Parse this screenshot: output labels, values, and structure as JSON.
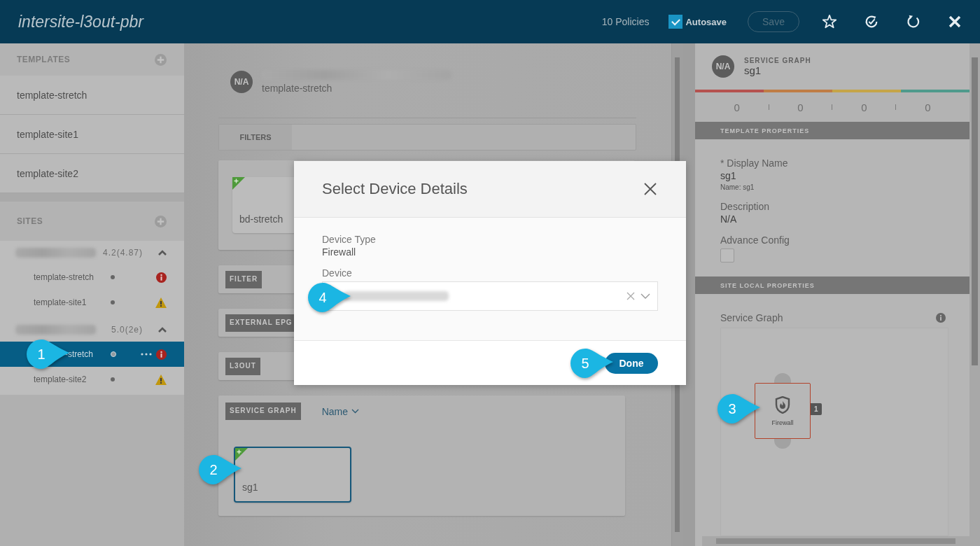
{
  "header": {
    "title": "intersite-l3out-pbr",
    "policies": "10 Policies",
    "autosave": {
      "label": "Autosave",
      "checked": true
    },
    "save": {
      "label": "Save",
      "disabled": true
    }
  },
  "sidebar": {
    "templates": {
      "heading": "TEMPLATES",
      "items": [
        {
          "label": "template-stretch",
          "selected": false
        },
        {
          "label": "template-site1",
          "selected": false
        },
        {
          "label": "template-site2",
          "selected": false
        }
      ]
    },
    "sites": {
      "heading": "SITES",
      "groups": [
        {
          "version": "4.2(4.87)",
          "expanded": true,
          "children": [
            {
              "label": "template-stretch",
              "kind": "error",
              "selected": false
            },
            {
              "label": "template-site1",
              "kind": "warning",
              "selected": false
            }
          ]
        },
        {
          "version": "5.0(2e)",
          "expanded": true,
          "children": [
            {
              "label": "-stretch",
              "kind": "error",
              "selected": true
            },
            {
              "label": "template-site2",
              "kind": "warning",
              "selected": false
            }
          ]
        }
      ]
    }
  },
  "schema": {
    "avatar": "N/A",
    "template": "template-stretch",
    "filters_label": "FILTERS",
    "bd_card": {
      "label": "bd-stretch",
      "added": true
    },
    "sections": [
      {
        "label": "FILTER"
      },
      {
        "label": "EXTERNAL EPG"
      },
      {
        "label": "L3OUT"
      }
    ],
    "service_graph": {
      "label": "SERVICE GRAPH",
      "sort": "Name",
      "cards": [
        {
          "label": "sg1",
          "added": true,
          "selected": true
        }
      ]
    }
  },
  "modal": {
    "title": "Select Device Details",
    "device_type_label": "Device Type",
    "device_type": "Firewall",
    "device_label": "Device",
    "done": "Done"
  },
  "properties": {
    "avatar": "N/A",
    "kind": "SERVICE GRAPH",
    "name": "sg1",
    "counts": [
      {
        "value": "0",
        "color": "#b5524f"
      },
      {
        "value": "0",
        "color": "#bf7d45"
      },
      {
        "value": "0",
        "color": "#c5a548"
      },
      {
        "value": "0",
        "color": "#4f9a8c"
      }
    ],
    "template_heading": "TEMPLATE PROPERTIES",
    "display_name_label": "* Display Name",
    "display_name": "sg1",
    "name_note": "Name: sg1",
    "description_label": "Description",
    "description": "N/A",
    "advance_label": "Advance Config",
    "advance_checked": false,
    "site_heading": "SITE LOCAL PROPERTIES",
    "graph_label": "Service Graph",
    "node": {
      "label": "Firewall",
      "count": "1"
    }
  },
  "callouts": [
    {
      "number": "1"
    },
    {
      "number": "2"
    },
    {
      "number": "3"
    },
    {
      "number": "4"
    },
    {
      "number": "5"
    }
  ]
}
